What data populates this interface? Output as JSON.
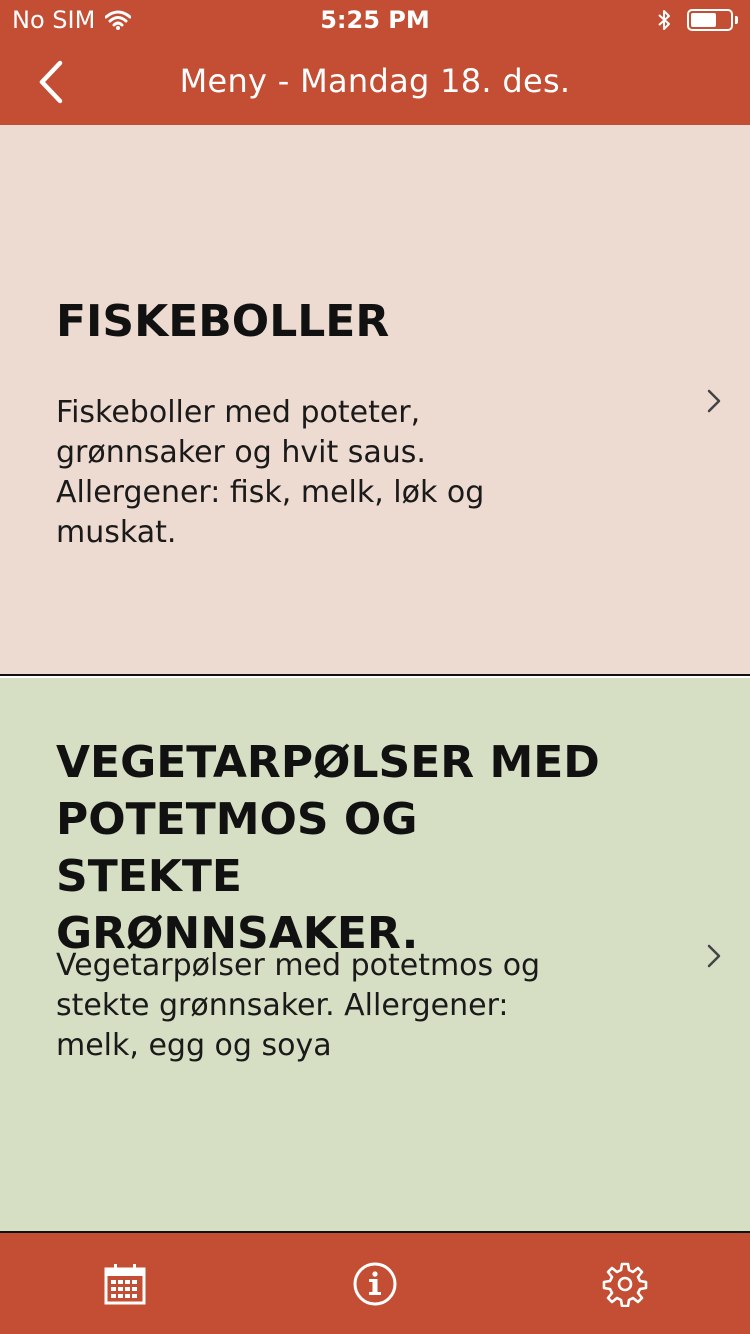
{
  "status_bar": {
    "carrier": "No SIM",
    "time": "5:25 PM",
    "battery_level": 0.7
  },
  "nav": {
    "title": "Meny - Mandag 18. des.",
    "back_icon": "chevron-left-icon"
  },
  "menu_items": [
    {
      "title": "FISKEBOLLER",
      "description": "Fiskeboller med poteter, grønnsaker og hvit saus. Allergener: fisk, melk, løk og muskat.",
      "background": "#eddad0"
    },
    {
      "title": "VEGETARPØLSER MED POTETMOS OG STEKTE GRØNNSAKER.",
      "description": "Vegetarpølser med potetmos og stekte grønnsaker. Allergener: melk, egg og soya",
      "background": "#d6dfc4"
    }
  ],
  "tab_bar": {
    "tabs": [
      {
        "icon": "calendar-icon"
      },
      {
        "icon": "info-icon"
      },
      {
        "icon": "settings-icon"
      }
    ]
  },
  "colors": {
    "accent": "#c44e33",
    "text": "#111111"
  }
}
